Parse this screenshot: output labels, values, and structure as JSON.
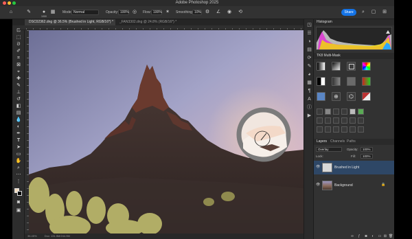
{
  "window": {
    "title": "Adobe Photoshop 2025"
  },
  "options_bar": {
    "mode_label": "Mode:",
    "mode_value": "Normal",
    "opacity_label": "Opacity:",
    "opacity_value": "100%",
    "flow_label": "Flow:",
    "flow_value": "100%",
    "smoothing_label": "Smoothing:",
    "smoothing_value": "10%",
    "brush_size": "1000",
    "share_label": "Share"
  },
  "tabs": [
    {
      "label": "DSC02362.dng @ 36.5% (Brushed in Light, RGB/16*) *"
    },
    {
      "label": "_FAN3302.dng @ 24.8% (RGB/16*) *"
    }
  ],
  "panels": {
    "histogram_title": "Histogram",
    "tk_title": "TK8 Multi-Mask",
    "layers": {
      "tabs": [
        "Layers",
        "Channels",
        "Paths"
      ],
      "blend_mode": "Overlay",
      "opacity_label": "Opacity:",
      "opacity_value": "100%",
      "lock_label": "Lock:",
      "fill_label": "Fill:",
      "fill_value": "100%",
      "items": [
        {
          "name": "Brushed in Light",
          "selected": true
        },
        {
          "name": "Background",
          "selected": false
        }
      ]
    }
  },
  "status": {
    "zoom": "36.45%",
    "doc": "Doc: 131.5M/244.9M"
  },
  "colors": {
    "accent": "#1473e6",
    "selected_layer": "#2e4766"
  }
}
